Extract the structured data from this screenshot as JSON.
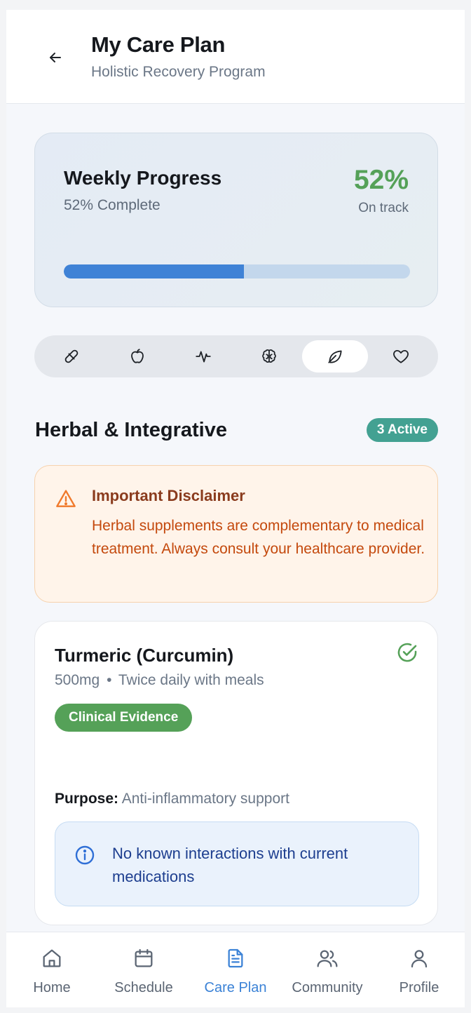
{
  "header": {
    "title": "My Care Plan",
    "subtitle": "Holistic Recovery Program",
    "back_icon": "arrow-left-icon"
  },
  "progress": {
    "title": "Weekly Progress",
    "subtitle": "52% Complete",
    "percent_label": "52%",
    "status": "On track",
    "fraction": 0.52,
    "accent": "#55a158",
    "bar_color": "#3f82d6"
  },
  "tabs": [
    {
      "icon": "pill-icon",
      "active": false
    },
    {
      "icon": "apple-icon",
      "active": false
    },
    {
      "icon": "activity-icon",
      "active": false
    },
    {
      "icon": "brain-icon",
      "active": false
    },
    {
      "icon": "leaf-icon",
      "active": true
    },
    {
      "icon": "heart-icon",
      "active": false
    }
  ],
  "section": {
    "title": "Herbal & Integrative",
    "badge": "3 Active",
    "badge_color": "#43a192"
  },
  "disclaimer": {
    "title": "Important Disclaimer",
    "body": "Herbal supplements are complementary to medical treatment. Always consult your healthcare provider.",
    "icon": "warning-triangle-icon"
  },
  "herb": {
    "name": "Turmeric (Curcumin)",
    "dose": "500mg",
    "separator": "•",
    "frequency": "Twice daily with meals",
    "evidence": "Clinical Evidence",
    "purpose_label": "Purpose:",
    "purpose": "Anti-inflammatory support",
    "interaction": "No known interactions with current medications",
    "status_icon": "check-circle-icon"
  },
  "nav": [
    {
      "label": "Home",
      "icon": "home-icon",
      "active": false
    },
    {
      "label": "Schedule",
      "icon": "calendar-icon",
      "active": false
    },
    {
      "label": "Care Plan",
      "icon": "document-icon",
      "active": true
    },
    {
      "label": "Community",
      "icon": "users-icon",
      "active": false
    },
    {
      "label": "Profile",
      "icon": "user-icon",
      "active": false
    }
  ]
}
